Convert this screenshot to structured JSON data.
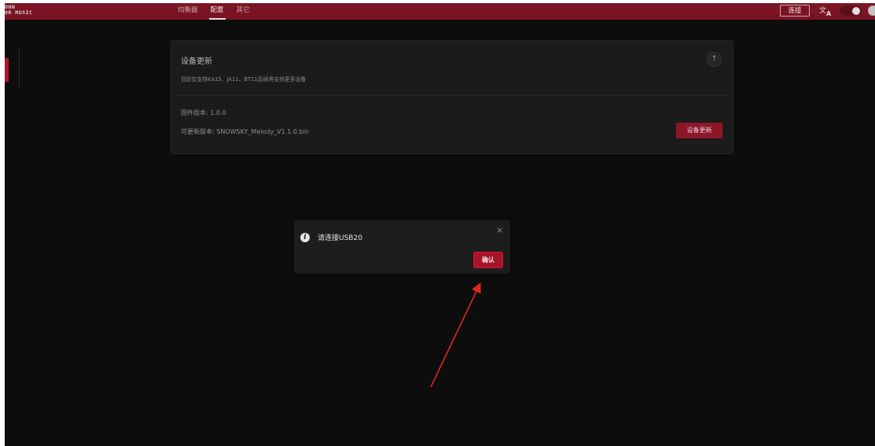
{
  "header": {
    "logo_line1": "OHN",
    "logo_line2": "OR MUSIC",
    "tabs": [
      {
        "label": "均衡器"
      },
      {
        "label": "配置"
      },
      {
        "label": "其它"
      }
    ],
    "connect_label": "连接"
  },
  "card": {
    "title": "设备更新",
    "subtitle": "目前仅支持KA15、JA11、BT11后续将支持更多设备",
    "firmware_version": "固件版本: 1.0.0",
    "update_version": "可更新版本: SNOWSKY_Melody_V1.1.0.bin",
    "update_button": "设备更新"
  },
  "dialog": {
    "message": "请连接USB20",
    "confirm_label": "确认",
    "close_glyph": "×"
  },
  "icons": {
    "collapse": "arrow-up-icon",
    "info": "info-icon",
    "translate": "translate-icon",
    "theme": "theme-toggle-icon"
  },
  "colors": {
    "header": "#7a1424",
    "accent": "#c4142c",
    "background": "#0d0d0d",
    "arrow": "#e0281f"
  }
}
